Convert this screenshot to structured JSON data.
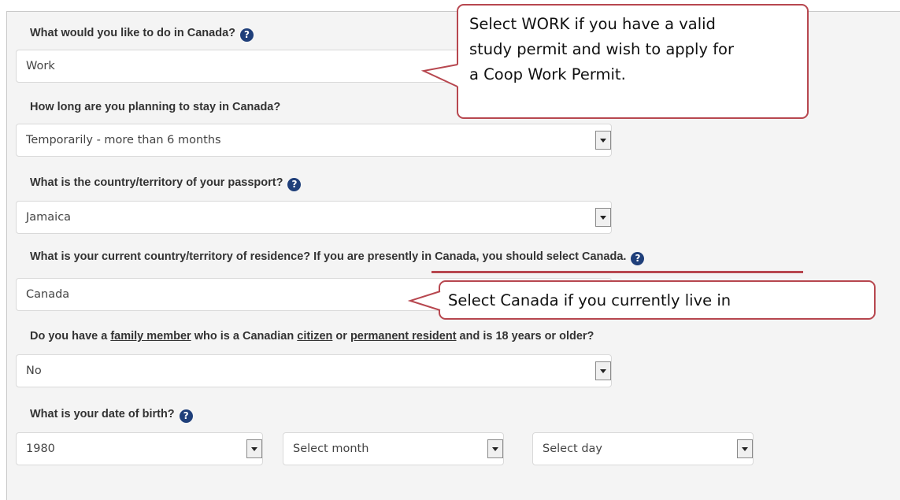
{
  "questions": {
    "activity": {
      "label": "What would you like to do in Canada?",
      "value": "Work"
    },
    "duration": {
      "label": "How long are you planning to stay in Canada?",
      "value": "Temporarily - more than 6 months"
    },
    "passport": {
      "label": "What is the country/territory of your passport?",
      "value": "Jamaica"
    },
    "residence": {
      "label_main": "What is your current country/territory of residence",
      "label_extra": "? If you are presently in Canada, you should select Canada.",
      "value": "Canada"
    },
    "family": {
      "prefix": "Do you have a ",
      "family_member_link": "family member",
      "middle1": " who is a Canadian ",
      "citizen_link": "citizen",
      "middle2": " or ",
      "permanent_resident_link": "permanent resident",
      "suffix": " and is 18 years or older?",
      "value": "No"
    },
    "birth": {
      "label": "What is your date of birth?",
      "year_value": "1980",
      "month_value": "Select month",
      "day_value": "Select day"
    }
  },
  "help_icon_glyph": "?",
  "callouts": {
    "work": {
      "lines": [
        "Select WORK if you have a valid",
        "study permit and wish to apply for",
        "a Coop Work Permit."
      ]
    },
    "canada": {
      "text": "Select Canada if you currently live in"
    }
  },
  "colors": {
    "panel_bg": "#f4f4f4",
    "help_icon": "#1f3f7a",
    "callout_border": "#b7474f"
  }
}
